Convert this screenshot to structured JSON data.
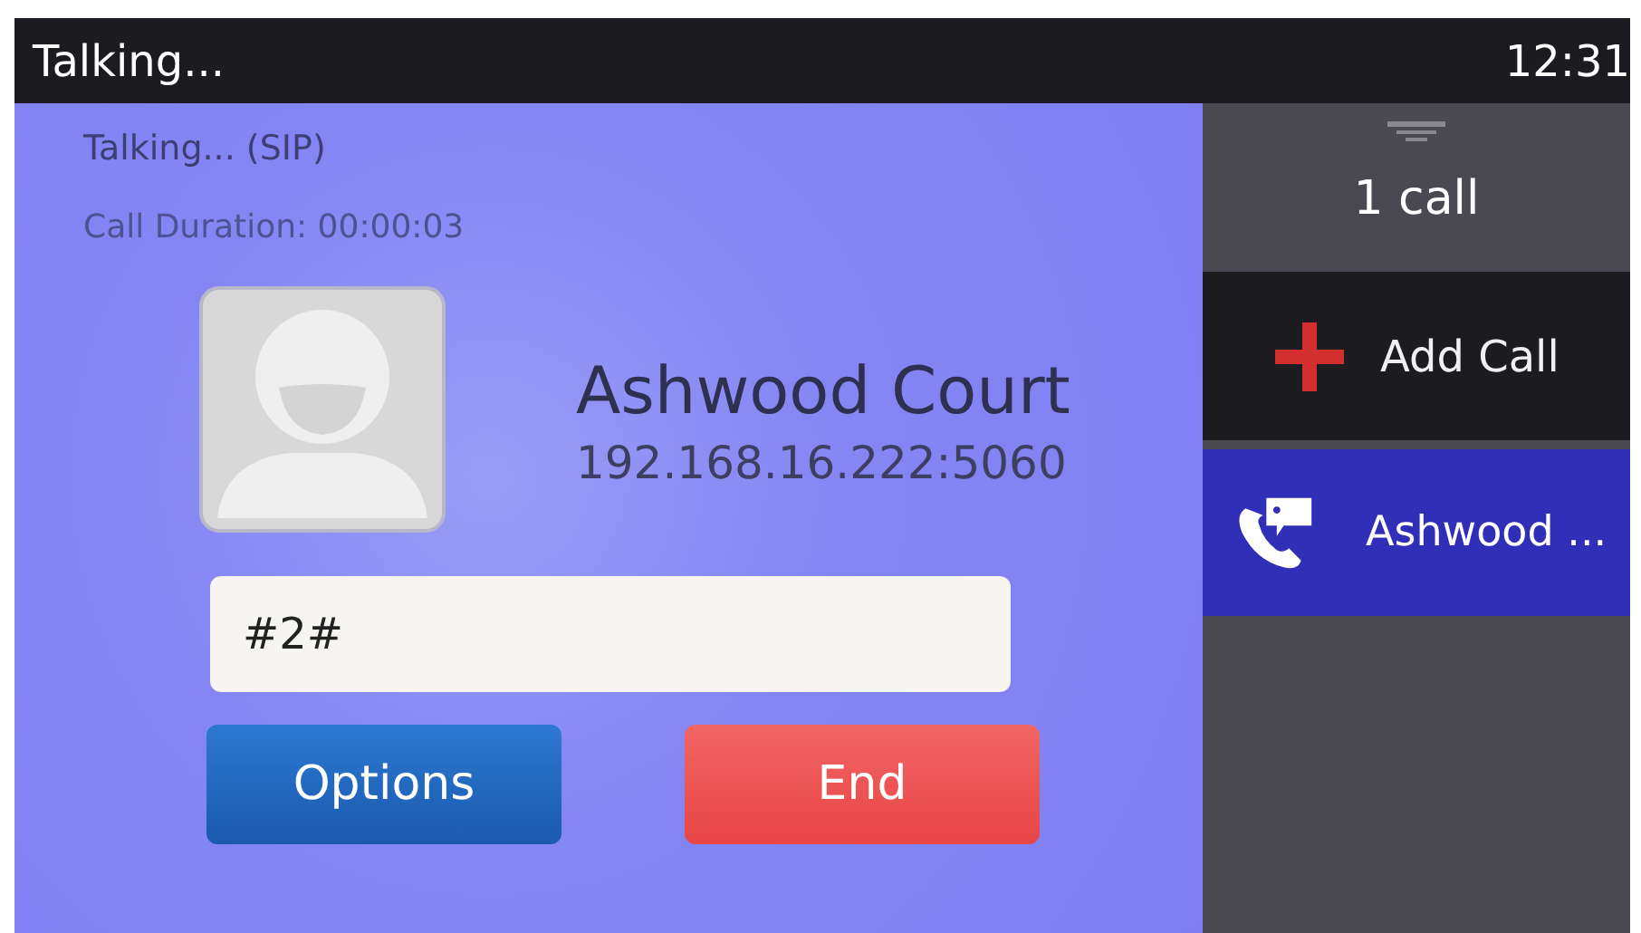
{
  "status_bar": {
    "title": "Talking...",
    "time": "12:31"
  },
  "call": {
    "state": "Talking... (SIP)",
    "duration": "Call Duration: 00:00:03",
    "name": "Ashwood Court",
    "address": "192.168.16.222:5060"
  },
  "dtmf_field": {
    "value": "#2#"
  },
  "buttons": [
    {
      "label": "Options",
      "kind": "options"
    },
    {
      "label": "End",
      "kind": "end"
    }
  ],
  "side_panel": {
    "count": "1 call",
    "add_call": "Add Call",
    "calls": [
      {
        "label": "Ashwood ...",
        "selected": true
      }
    ]
  }
}
